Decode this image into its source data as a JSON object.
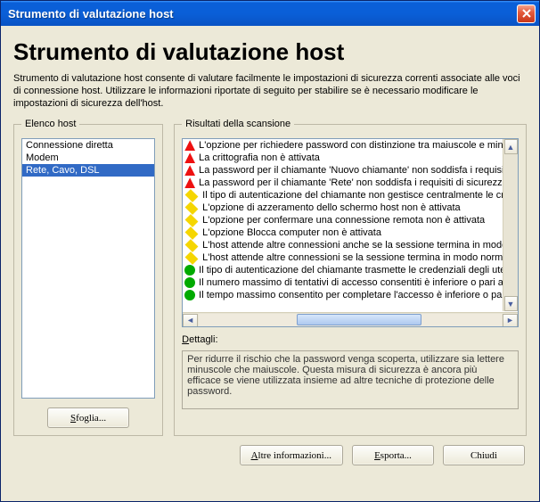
{
  "window": {
    "title": "Strumento di valutazione host"
  },
  "page": {
    "heading": "Strumento di valutazione host",
    "intro": "Strumento di valutazione host consente di valutare facilmente le impostazioni di sicurezza correnti associate alle voci di connessione host. Utilizzare le informazioni riportate di seguito per stabilire se è necessario modificare le impostazioni di sicurezza dell'host."
  },
  "hostlist": {
    "legend": "Elenco host",
    "items": [
      {
        "label": "Connessione diretta",
        "selected": false
      },
      {
        "label": "Modem",
        "selected": false
      },
      {
        "label": "Rete, Cavo, DSL",
        "selected": true
      }
    ],
    "browse_btn": "Sfoglia..."
  },
  "scan": {
    "legend": "Risultati della scansione",
    "rows": [
      {
        "sev": "red",
        "text": "L'opzione per richiedere password con distinzione tra maiuscole e minus"
      },
      {
        "sev": "red",
        "text": "La crittografia non è attivata"
      },
      {
        "sev": "red",
        "text": "La password per il chiamante 'Nuovo chiamante' non soddisfa i requisiti"
      },
      {
        "sev": "red",
        "text": "La password per il chiamante 'Rete' non soddisfa i requisiti di sicurezza"
      },
      {
        "sev": "yellow",
        "text": "Il tipo di autenticazione del chiamante non gestisce centralmente le cre"
      },
      {
        "sev": "yellow",
        "text": "L'opzione di azzeramento dello schermo host non è attivata"
      },
      {
        "sev": "yellow",
        "text": "L'opzione per confermare una connessione remota non è attivata"
      },
      {
        "sev": "yellow",
        "text": "L'opzione Blocca computer non è attivata"
      },
      {
        "sev": "yellow",
        "text": "L'host attende altre connessioni anche se la sessione termina in modo a"
      },
      {
        "sev": "yellow",
        "text": "L'host attende altre connessioni se la sessione termina in modo normale"
      },
      {
        "sev": "green",
        "text": "Il tipo di autenticazione del chiamante trasmette le credenziali degli ute"
      },
      {
        "sev": "green",
        "text": "Il numero massimo di tentativi di accesso consentiti è inferiore o pari a"
      },
      {
        "sev": "green",
        "text": "Il tempo massimo consentito per completare l'accesso è inferiore o pari"
      }
    ],
    "details_label": "Dettagli:",
    "details_text": "Per ridurre il rischio che la password venga scoperta, utilizzare sia lettere minuscole che maiuscole. Questa misura di sicurezza è ancora più efficace se viene utilizzata insieme ad altre tecniche di protezione delle password."
  },
  "buttons": {
    "more_info": "Altre informazioni...",
    "export": "Esporta...",
    "close": "Chiudi"
  }
}
